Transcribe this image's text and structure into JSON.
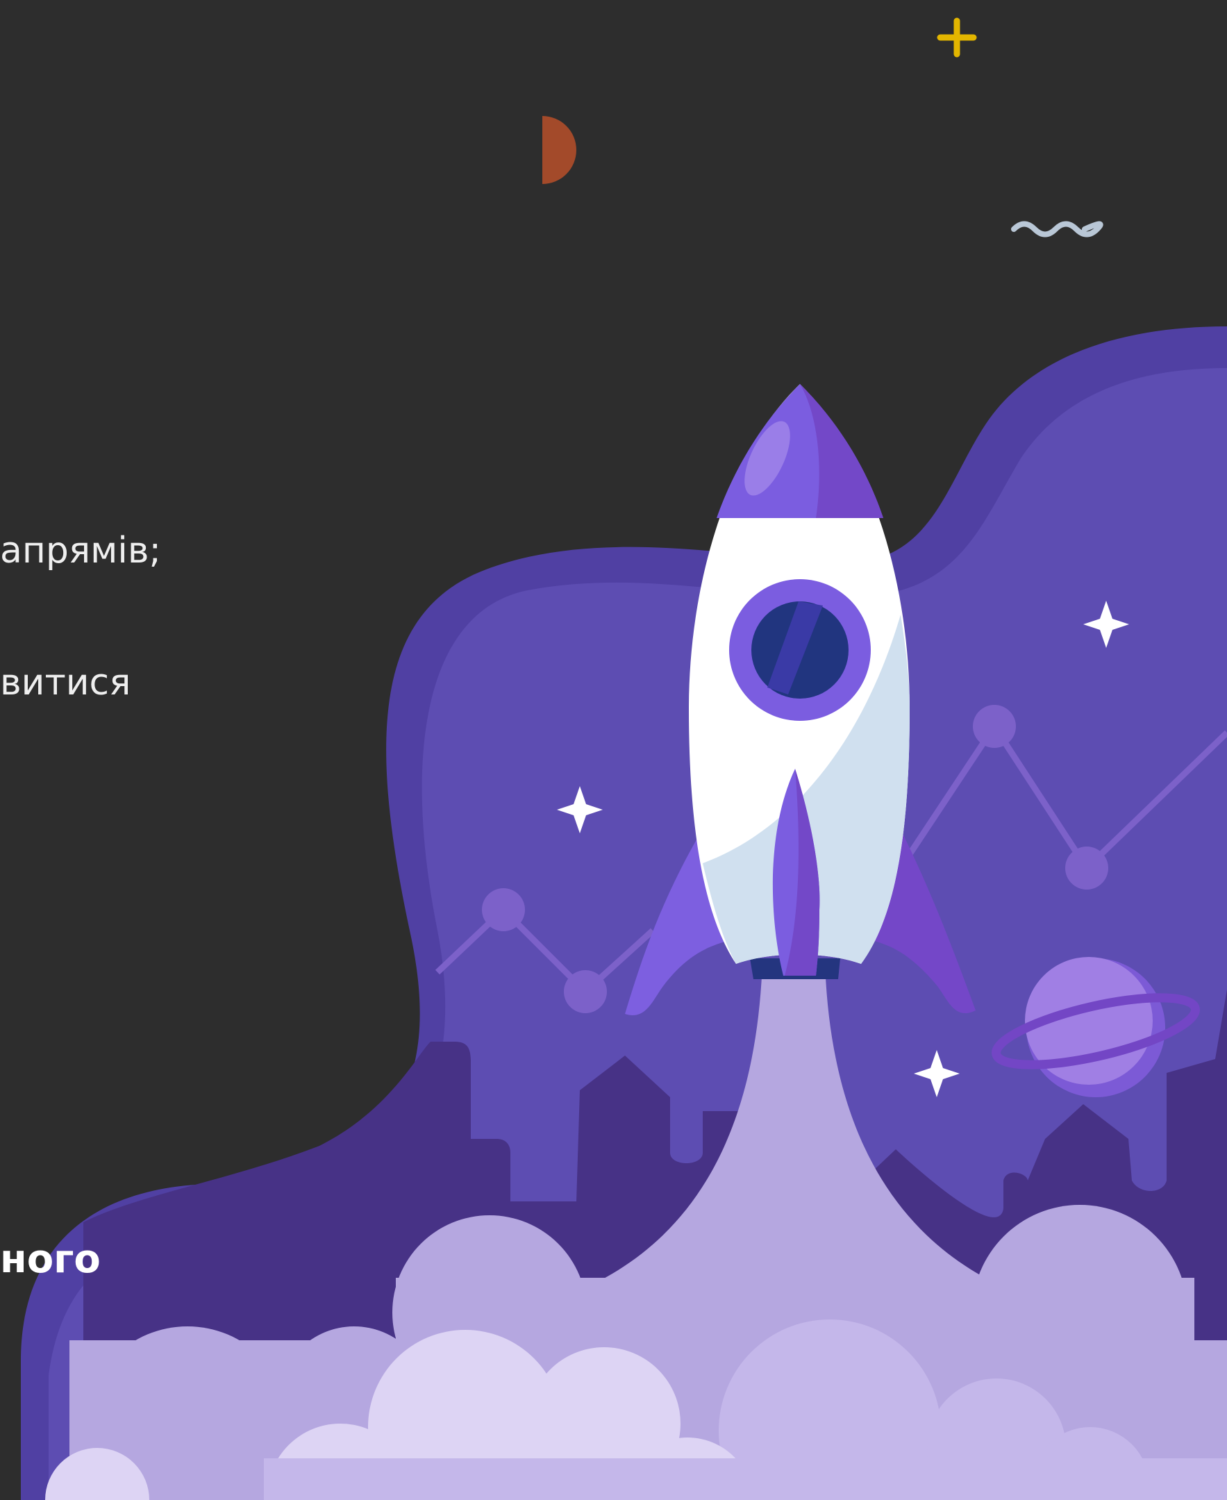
{
  "text": {
    "fragment_1": "апрямів;",
    "fragment_2": "витися",
    "fragment_3": "ного"
  },
  "colors": {
    "background": "#2d2d2d",
    "purple_dark": "#4a2f86",
    "purple_mid": "#5b4db0",
    "purple_light": "#7e62d9",
    "cloud_light": "#dcd3f3",
    "cloud_mid": "#b7a7e2",
    "rocket_white": "#ffffff",
    "rocket_window": "#21357f",
    "moon_orange": "#a34a2a",
    "star_yellow": "#e3b600"
  },
  "icons": [
    "plus-star-icon",
    "half-moon-icon",
    "wave-icon",
    "sparkle-icon",
    "rocket-icon",
    "planet-icon"
  ]
}
